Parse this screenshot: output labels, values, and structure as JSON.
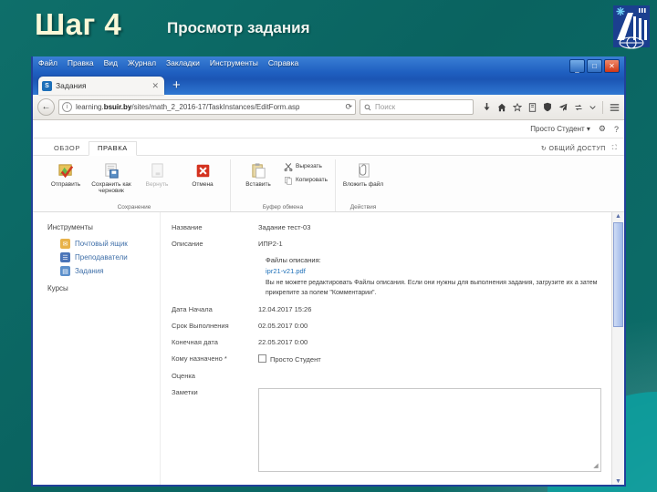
{
  "slide": {
    "title": "Шаг 4",
    "subtitle": "Просмотр задания",
    "logo_alt": "bsuir-logo"
  },
  "browser": {
    "menu": [
      "Файл",
      "Правка",
      "Вид",
      "Журнал",
      "Закладки",
      "Инструменты",
      "Справка"
    ],
    "window_controls": {
      "minimize": "_",
      "maximize": "□",
      "close": "✕"
    },
    "tab": {
      "favicon": "S",
      "title": "Задания",
      "close": "✕",
      "new_tab": "+"
    },
    "nav": {
      "back": "←",
      "info": "i",
      "url_prefix": "learning.",
      "url_domain": "bsuir.by",
      "url_suffix": "/sites/math_2_2016-17/TaskInstances/EditForm.asp",
      "reload": "⟳",
      "search_placeholder": "Поиск",
      "search_icon": "🔍",
      "icons": [
        "download-icon",
        "home-icon",
        "bookmark-star-icon",
        "library-icon",
        "shield-icon",
        "pocket-send-icon",
        "sync-icon",
        "chevron-down-icon",
        "hamburger-menu-icon"
      ]
    }
  },
  "suitebar": {
    "user": "Просто Студент",
    "user_caret": "▾",
    "settings_icon": "⚙",
    "help_icon": "?"
  },
  "ribbon": {
    "tabs": [
      {
        "label": "ОБЗОР",
        "active": false
      },
      {
        "label": "ПРАВКА",
        "active": true
      }
    ],
    "share_label": "ОБЩИЙ ДОСТУП",
    "share_icon": "↻",
    "focus_icon": "⛶",
    "groups": [
      {
        "title": "Сохранение",
        "buttons": [
          {
            "label": "Отправить",
            "icon": "save-submit-icon",
            "disabled": false
          },
          {
            "label": "Сохранить как черновик",
            "icon": "save-draft-icon",
            "disabled": false
          },
          {
            "label": "Вернуть",
            "icon": "revert-icon",
            "disabled": true
          },
          {
            "label": "Отмена",
            "icon": "cancel-icon",
            "disabled": false
          }
        ]
      },
      {
        "title": "Буфер обмена",
        "buttons": [
          {
            "label": "Вставить",
            "icon": "paste-icon",
            "disabled": false
          },
          {
            "label": "Вырезать",
            "icon": "cut-scissors-icon",
            "disabled": false
          },
          {
            "label": "Копировать",
            "icon": "copy-icon",
            "disabled": false
          }
        ]
      },
      {
        "title": "Действия",
        "buttons": [
          {
            "label": "Вложить файл",
            "icon": "attach-file-icon",
            "disabled": false
          }
        ]
      }
    ]
  },
  "sidebar": {
    "header": "Инструменты",
    "items": [
      {
        "label": "Почтовый ящик",
        "icon": "mailbox-icon",
        "color": "#e8b24a"
      },
      {
        "label": "Преподаватели",
        "icon": "teachers-icon",
        "color": "#4a74b8"
      },
      {
        "label": "Задания",
        "icon": "tasks-icon",
        "color": "#5b8fcb"
      }
    ],
    "footer": "Курсы"
  },
  "form": {
    "fields": [
      {
        "label": "Название",
        "value": "Задание тест-03"
      },
      {
        "label": "Описание",
        "value": "ИПР2-1"
      }
    ],
    "files": {
      "title": "Файлы описания:",
      "link": "ipr21-v21.pdf",
      "note": "Вы не можете редактировать Файлы описания. Если они нужны для выполнения задания, загрузите их а затем прикрепите за полем \"Комментарии\"."
    },
    "dates": [
      {
        "label": "Дата Начала",
        "value": "12.04.2017 15:26"
      },
      {
        "label": "Срок Выполнения",
        "value": "02.05.2017 0:00"
      },
      {
        "label": "Конечная дата",
        "value": "22.05.2017 0:00"
      }
    ],
    "assigned": {
      "label": "Кому назначено *",
      "value": "Просто Студент",
      "checked": false
    },
    "grade": {
      "label": "Оценка",
      "value": ""
    },
    "notes": {
      "label": "Заметки",
      "value": ""
    }
  },
  "scrollbar": {
    "up_arrow": "▲",
    "down_arrow": "▼"
  }
}
